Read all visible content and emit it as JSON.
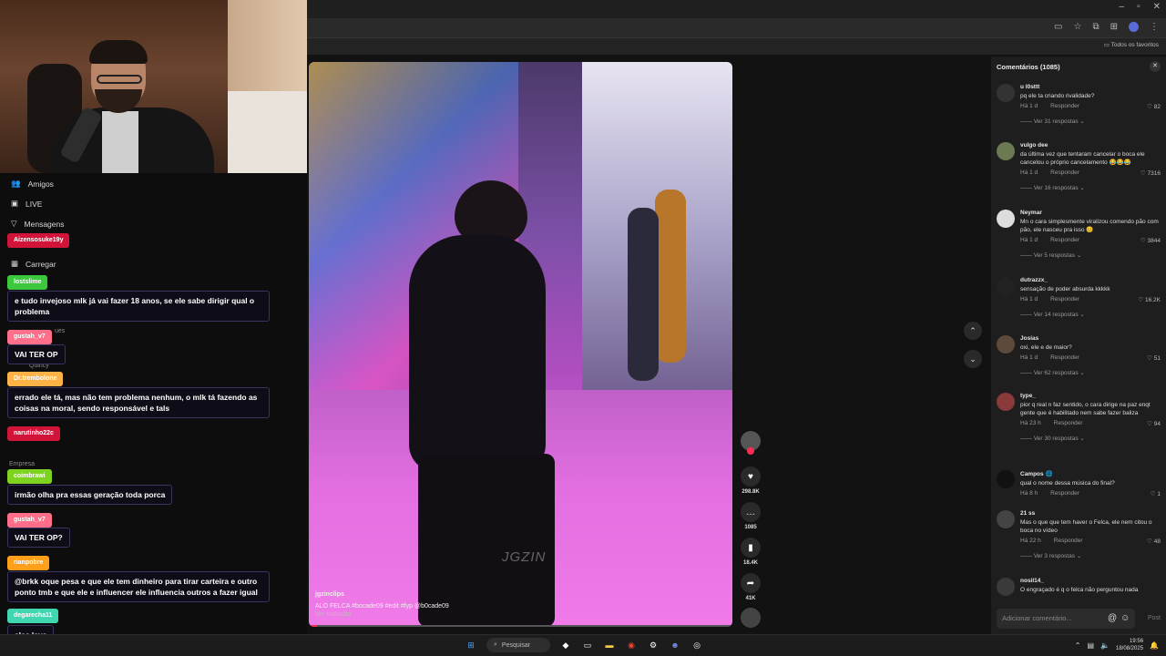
{
  "window": {
    "minimize": "–",
    "maximize": "▫",
    "close": "✕"
  },
  "bookmarks": {
    "all_favorites": "Todos os favoritos"
  },
  "left_panel": {
    "nav": [
      {
        "label": "Amigos",
        "icon": "friends-icon"
      },
      {
        "label": "LIVE",
        "icon": "live-icon"
      },
      {
        "label": "Mensagens",
        "icon": "messages-icon"
      },
      {
        "label": "Carregar",
        "icon": "upload-icon"
      }
    ],
    "ghost_text": [
      "ues",
      "Quincy",
      "Empresa"
    ]
  },
  "chat": [
    {
      "user": "Aizensosuke19y",
      "color": "#d2143a",
      "message": ""
    },
    {
      "user": "lostslime",
      "color": "#3cc83c",
      "message": "e tudo invejoso mlk já vai fazer 18 anos, se ele sabe dirigir qual o problema"
    },
    {
      "user": "gustah_v7",
      "color": "#ff6f8a",
      "message": "VAI TER OP"
    },
    {
      "user": "Dr.trembolone",
      "color": "#ffb347",
      "message": "errado ele tá, mas não tem problema nenhum, o mlk tá fazendo as coisas na moral, sendo responsável e tals"
    },
    {
      "user": "narutinho22c",
      "color": "#d2143a",
      "message": ""
    },
    {
      "user": "coimbrawi",
      "color": "#7ed321",
      "message": "irmão olha pra essas geração toda porca"
    },
    {
      "user": "gustah_v7",
      "color": "#ff6f8a",
      "message": "VAI TER OP?"
    },
    {
      "user": "rianpobre",
      "color": "#ff9f1a",
      "message": "@brkk oque pesa e que ele tem dinheiro para tirar carteira e outro ponto tmb e que ele e influencer ele influencia outros a fazer igual"
    },
    {
      "user": "degarecha11",
      "color": "#3fd6b0",
      "message": "eles leva"
    }
  ],
  "video": {
    "watermark": "JGZIN",
    "author": "jgzinclips",
    "caption": "ALO FELCA #bocade09 #edit #fyp @b0cade09",
    "translate": "Ver tradução",
    "progress": 0.02
  },
  "actions": [
    {
      "name": "like",
      "icon": "heart-icon",
      "glyph": "♥",
      "count": "298.8K"
    },
    {
      "name": "comment",
      "icon": "comment-icon",
      "glyph": "…",
      "count": "1085"
    },
    {
      "name": "save",
      "icon": "bookmark-icon",
      "glyph": "▮",
      "count": "18.4K"
    },
    {
      "name": "share",
      "icon": "share-icon",
      "glyph": "➦",
      "count": "41K"
    }
  ],
  "nav": {
    "up": "⌃",
    "down": "⌄"
  },
  "comments": {
    "title": "Comentários (1085)",
    "reply_label": "Responder",
    "items": [
      {
        "user": "u l0sttt",
        "text": "pq ele ta criando rivalidade?",
        "time": "Há 1 d",
        "likes": "82",
        "replies": "Ver 31 respostas"
      },
      {
        "user": "vulgo dee",
        "text": "da última vez que tentaram cancelar o boca ele cancelou o próprio cancelamento 😂😂😂",
        "time": "Há 1 d",
        "likes": "7316",
        "replies": "Ver 16 respostas"
      },
      {
        "user": "Neymar",
        "text": "Mn o cara simplesmente viralizou comendo pão com pão, ele nasceu pra isso 😊",
        "time": "Há 1 d",
        "likes": "3844",
        "replies": "Ver 5 respostas"
      },
      {
        "user": "dutrazzx_",
        "text": "sensação de poder absurda kkkkk",
        "time": "Há 1 d",
        "likes": "16.2K",
        "replies": "Ver 14 respostas"
      },
      {
        "user": "Josias",
        "text": "oxi, ele e de maior?",
        "time": "Há 1 d",
        "likes": "51",
        "replies": "Ver 62 respostas"
      },
      {
        "user": "type_",
        "text": "pior q real n faz sentido, o cara dirige na paz enqt gente que é habilitado nem sabe fazer baliza",
        "time": "Há 23 h",
        "likes": "94",
        "replies": "Ver 30 respostas"
      },
      {
        "user": "Campos 🌐",
        "text": "qual o nome dessa música do final?",
        "time": "Há 8 h",
        "likes": "1",
        "replies": ""
      },
      {
        "user": "21 ss",
        "text": "Mas o que que tem haver o Felca, ele nem citou o boca no vídeo",
        "time": "Há 22 h",
        "likes": "48",
        "replies": "Ver 3 respostas"
      },
      {
        "user": "nosil14_",
        "text": "O engraçado é q o felca não perguntou nada",
        "time": "",
        "likes": "",
        "replies": ""
      }
    ],
    "input_placeholder": "Adicionar comentário...",
    "post": "Post"
  },
  "taskbar": {
    "search": "Pesquisar",
    "time": "19:56",
    "date": "18/08/2025"
  }
}
